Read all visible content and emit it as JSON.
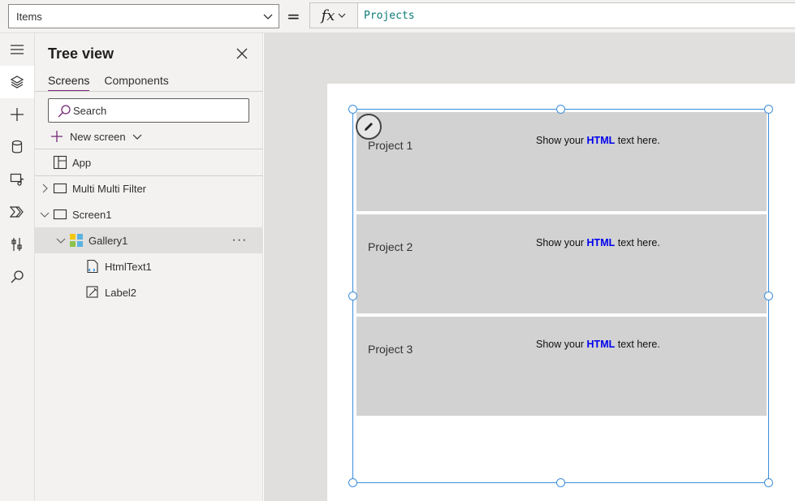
{
  "formula_bar": {
    "property": "Items",
    "equals": "=",
    "fx_label": "fx",
    "formula": "Projects"
  },
  "rail": {
    "items": [
      {
        "icon": "hamburger-icon"
      },
      {
        "icon": "layers-icon",
        "active": true
      },
      {
        "icon": "plus-icon"
      },
      {
        "icon": "database-icon"
      },
      {
        "icon": "media-icon"
      },
      {
        "icon": "power-automate-icon"
      },
      {
        "icon": "tools-icon"
      },
      {
        "icon": "search-icon"
      }
    ]
  },
  "tree_view": {
    "title": "Tree view",
    "tabs": [
      {
        "label": "Screens",
        "active": true
      },
      {
        "label": "Components",
        "active": false
      }
    ],
    "search_placeholder": "Search",
    "new_screen_label": "New screen",
    "items": [
      {
        "label": "App"
      },
      {
        "label": "Multi Multi Filter"
      },
      {
        "label": "Screen1"
      },
      {
        "label": "Gallery1",
        "selected": true,
        "more": "···"
      },
      {
        "label": "HtmlText1"
      },
      {
        "label": "Label2"
      }
    ]
  },
  "gallery": {
    "items": [
      {
        "title": "Project 1",
        "html_pre": "Show your ",
        "html_bold": "HTML",
        "html_post": " text here."
      },
      {
        "title": "Project 2",
        "html_pre": "Show your ",
        "html_bold": "HTML",
        "html_post": " text here."
      },
      {
        "title": "Project 3",
        "html_pre": "Show your ",
        "html_bold": "HTML",
        "html_post": " text here."
      }
    ]
  },
  "colors": {
    "selection": "#3c8dd9",
    "accent": "#742774",
    "gallery_item_bg": "#d2d2d2",
    "html_bold": "#0000ee"
  }
}
